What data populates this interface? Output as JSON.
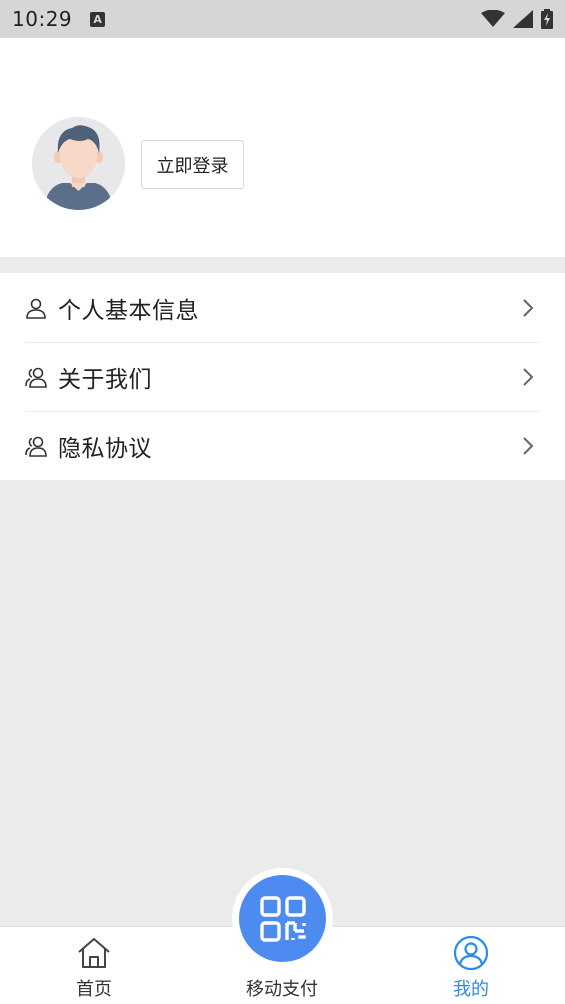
{
  "status_bar": {
    "time": "10:29",
    "notification_letter": "A",
    "icons": [
      "wifi-icon",
      "signal-icon",
      "battery-charging-icon"
    ]
  },
  "profile": {
    "login_label": "立即登录",
    "avatar_icon": "default-user-avatar"
  },
  "menu": {
    "items": [
      {
        "label": "个人基本信息",
        "icon": "person-icon"
      },
      {
        "label": "关于我们",
        "icon": "people-icon"
      },
      {
        "label": "隐私协议",
        "icon": "people-icon"
      }
    ]
  },
  "bottom_nav": {
    "home_label": "首页",
    "pay_label": "移动支付",
    "mine_label": "我的",
    "active": "我的"
  },
  "colors": {
    "accent": "#2a8be8",
    "fab": "#4d8bf0",
    "page_bg": "#ebebeb",
    "status_bar_bg": "#d6d6d6"
  }
}
